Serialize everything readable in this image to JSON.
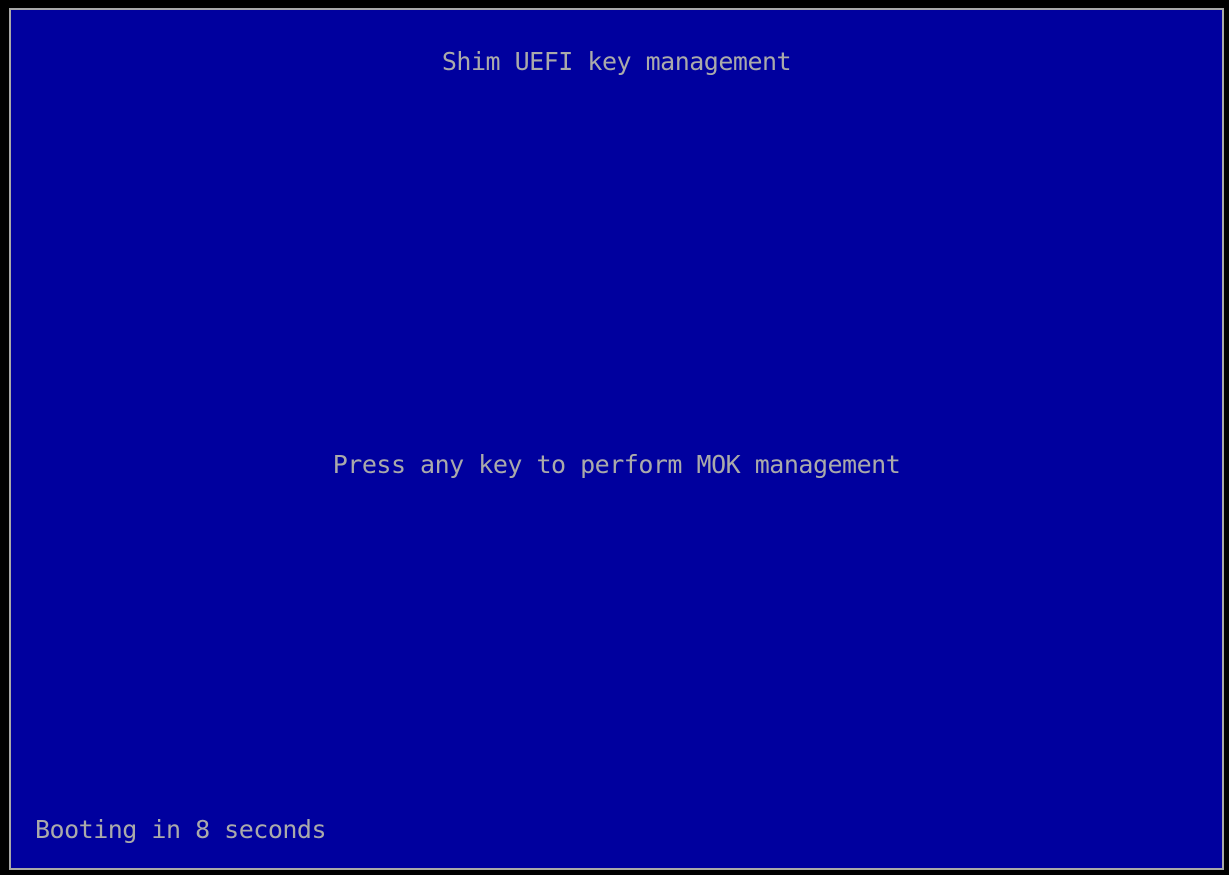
{
  "window": {
    "title": "Shim UEFI key management"
  },
  "main": {
    "prompt": "Press any key to perform MOK management"
  },
  "footer": {
    "status": "Booting in 8 seconds"
  },
  "colors": {
    "background": "#00009e",
    "text": "#aaaaaa",
    "border": "#a8a8a8"
  }
}
